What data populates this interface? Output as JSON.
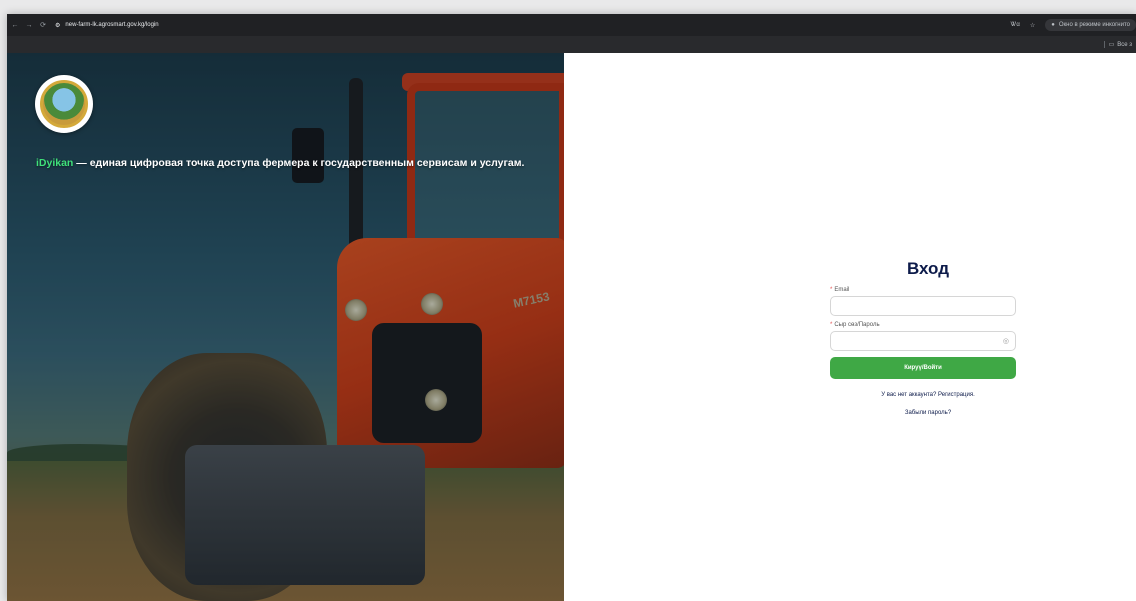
{
  "browser": {
    "back_icon": "←",
    "forward_icon": "→",
    "reload_icon": "⟳",
    "site_info_icon": "⚙",
    "url": "new-farm-lk.agrosmart.gov.kg/login",
    "lang_icon": "Ꮤα",
    "star_icon": "☆",
    "incognito_label": "Окно в режиме инкогнито",
    "bookmarks_label": "Все з"
  },
  "hero": {
    "model": "M7153",
    "brand": "iDyikan",
    "tagline": " — единая цифровая точка доступа фермера к государственным сервисам и услугам."
  },
  "login": {
    "title": "Вход",
    "email_label": "Email",
    "email_value": "",
    "password_label": "Сыр сөз/Пароль",
    "password_value": "",
    "submit_label": "Кируү/Войти",
    "register_link": "У вас нет аккаунта? Регистрация.",
    "forgot_link": "Забыли пароль?"
  },
  "colors": {
    "accent": "#3fa845",
    "brand_green": "#3fe07a",
    "title": "#0d1b4a"
  }
}
